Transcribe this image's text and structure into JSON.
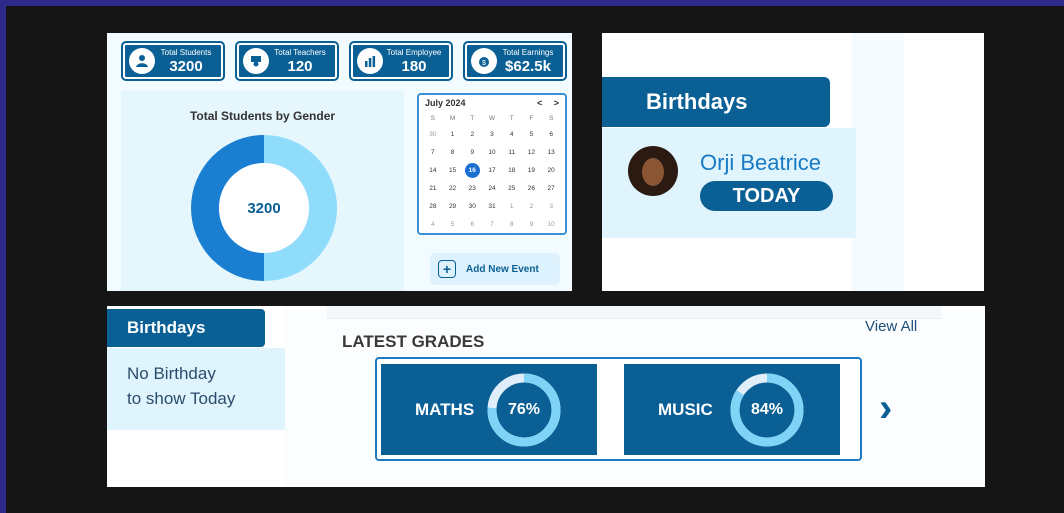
{
  "stats": [
    {
      "label": "Total Students",
      "value": "3200",
      "icon": "student-icon"
    },
    {
      "label": "Total Teachers",
      "value": "120",
      "icon": "teacher-icon"
    },
    {
      "label": "Total Employee",
      "value": "180",
      "icon": "employee-icon"
    },
    {
      "label": "Total Earnings",
      "value": "$62.5k",
      "icon": "money-bag-icon"
    }
  ],
  "gender_chart": {
    "title": "Total Students by Gender",
    "center_value": "3200",
    "colors": {
      "primary": "#1a7fd0",
      "secondary": "#8fdcfb"
    }
  },
  "calendar": {
    "month": "July 2024",
    "prev": "<",
    "next": ">",
    "weekdays": [
      "S",
      "M",
      "T",
      "W",
      "T",
      "F",
      "S"
    ],
    "days": [
      "30",
      "1",
      "2",
      "3",
      "4",
      "5",
      "6",
      "7",
      "8",
      "9",
      "10",
      "11",
      "12",
      "13",
      "14",
      "15",
      "16",
      "17",
      "18",
      "19",
      "20",
      "21",
      "22",
      "23",
      "24",
      "25",
      "26",
      "27",
      "28",
      "29",
      "30",
      "31",
      "1",
      "2",
      "3",
      "4",
      "5",
      "6",
      "7",
      "8",
      "9",
      "10"
    ],
    "selected": "16"
  },
  "add_event": {
    "label": "Add New Event"
  },
  "birthdays_card": {
    "title": "Birthdays",
    "name": "Orji Beatrice",
    "badge": "TODAY"
  },
  "birthdays_empty": {
    "title": "Birthdays",
    "line1": "No Birthday",
    "line2": "to show Today"
  },
  "grades": {
    "title": "LATEST GRADES",
    "view_all": "View All",
    "items": [
      {
        "subject": "MATHS",
        "percent": "76%",
        "value": 0.76
      },
      {
        "subject": "MUSIC",
        "percent": "84%",
        "value": 0.84
      }
    ],
    "next": "›"
  },
  "colors": {
    "brand": "#0a5f95",
    "accent": "#1a7ac4",
    "light": "#dff4fd"
  }
}
